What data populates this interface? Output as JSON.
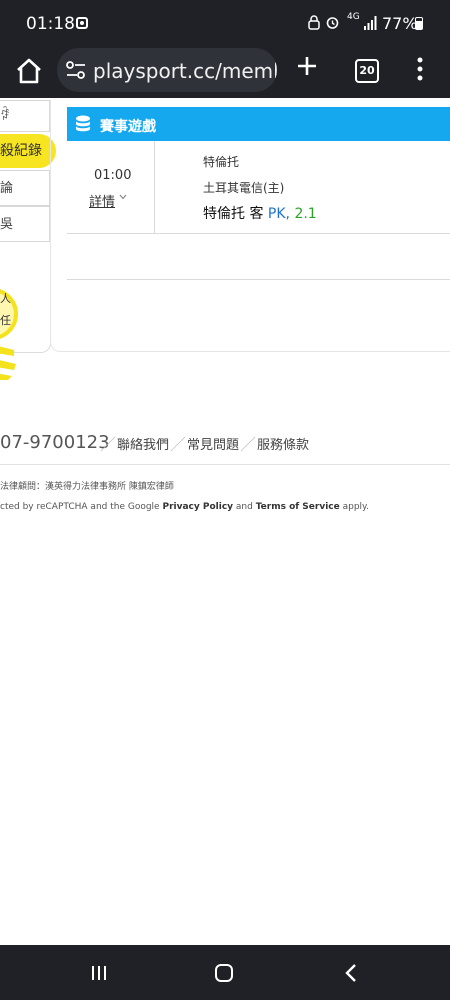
{
  "status_bar": {
    "time": "01:18",
    "network": "4G",
    "battery": "77%"
  },
  "browser": {
    "url": "playsport.cc/meml",
    "tab_count": "20"
  },
  "sidebar": {
    "items": [
      {
        "label": "ꆄ"
      },
      {
        "label": "殺紀錄",
        "active": true
      },
      {
        "label": "論"
      },
      {
        "label": "吳"
      }
    ]
  },
  "game_panel": {
    "title": "賽事遊戲",
    "header_color": "#16a8ee",
    "game": {
      "time": "01:00",
      "detail_label": "詳情",
      "home_team": "特倫托",
      "away_team": "土耳其電信(主)",
      "pick_team": "特倫托",
      "pick_side": "客",
      "pick_type": "PK,",
      "pick_value": "2.1"
    }
  },
  "bulb_text": [
    "人",
    "任"
  ],
  "footer": {
    "phone": "07-9700123",
    "links": [
      "聯絡我們",
      "常見問題",
      "服務條款"
    ],
    "legal": "法律顧問：漢英得力法律事務所 陳鎮宏律師",
    "captcha_prefix": "cted by reCAPTCHA and the Google",
    "privacy": "Privacy Policy",
    "and": "and",
    "terms": "Terms of Service",
    "apply": "apply."
  }
}
